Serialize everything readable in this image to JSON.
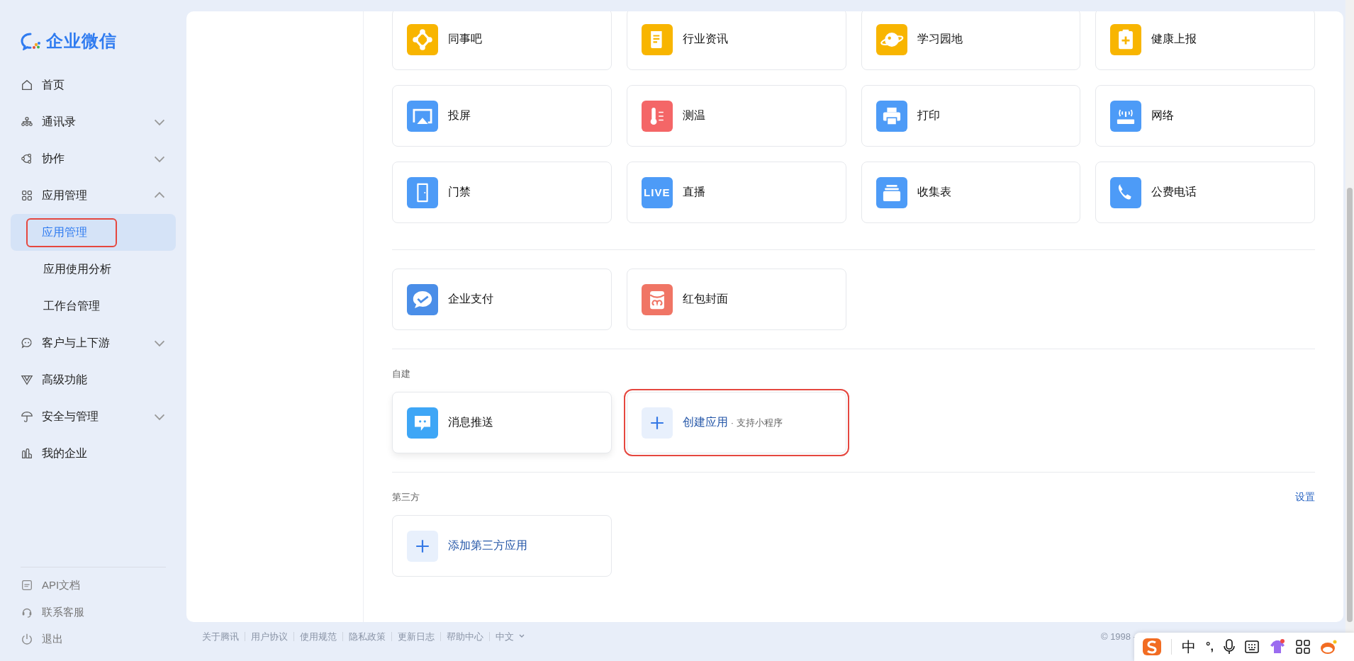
{
  "sidebar": {
    "logo": "企业微信",
    "items": [
      {
        "label": "首页",
        "kind": "home"
      },
      {
        "label": "通讯录",
        "kind": "contacts",
        "expanded": false
      },
      {
        "label": "协作",
        "kind": "collab",
        "expanded": false
      },
      {
        "label": "应用管理",
        "kind": "apps",
        "expanded": true,
        "children": [
          {
            "label": "应用管理",
            "selected": true,
            "annotated": true
          },
          {
            "label": "应用使用分析",
            "selected": false,
            "annotated": false
          },
          {
            "label": "工作台管理",
            "selected": false,
            "annotated": false
          }
        ]
      },
      {
        "label": "客户与上下游",
        "kind": "customer",
        "expanded": false
      },
      {
        "label": "高级功能",
        "kind": "advanced"
      },
      {
        "label": "安全与管理",
        "kind": "security",
        "expanded": false
      },
      {
        "label": "我的企业",
        "kind": "company"
      }
    ],
    "bottom_links": [
      {
        "label": "API文档",
        "kind": "api"
      },
      {
        "label": "联系客服",
        "kind": "support"
      },
      {
        "label": "退出",
        "kind": "logout"
      }
    ]
  },
  "sections": [
    {
      "apps": [
        {
          "name": "同事吧",
          "kind": "colleague"
        },
        {
          "name": "行业资讯",
          "kind": "news"
        },
        {
          "name": "学习园地",
          "kind": "planet"
        },
        {
          "name": "健康上报",
          "kind": "health"
        },
        {
          "name": "投屏",
          "kind": "cast"
        },
        {
          "name": "测温",
          "kind": "thermo"
        },
        {
          "name": "打印",
          "kind": "print"
        },
        {
          "name": "网络",
          "kind": "network"
        },
        {
          "name": "门禁",
          "kind": "door"
        },
        {
          "name": "直播",
          "kind": "live",
          "icon_text": "LIVE"
        },
        {
          "name": "收集表",
          "kind": "form"
        },
        {
          "name": "公费电话",
          "kind": "phone"
        }
      ]
    },
    {
      "apps": [
        {
          "name": "企业支付",
          "kind": "pay"
        },
        {
          "name": "红包封面",
          "kind": "redpacket"
        }
      ]
    },
    {
      "title": "自建",
      "apps": [
        {
          "name": "消息推送",
          "kind": "message"
        },
        {
          "name": "创建应用",
          "note": "· 支持小程序",
          "kind": "add",
          "annotated": true
        }
      ]
    },
    {
      "title": "第三方",
      "action": "设置",
      "apps": [
        {
          "name": "添加第三方应用",
          "kind": "add",
          "annotated": false
        }
      ]
    }
  ],
  "footer": {
    "links": [
      "关于腾讯",
      "用户协议",
      "使用规范",
      "隐私政策",
      "更新日志",
      "帮助中心"
    ],
    "language": "中文",
    "copyright": "© 1998 -"
  },
  "ime_bar": {
    "mode": "中",
    "punctuation": "°,"
  }
}
